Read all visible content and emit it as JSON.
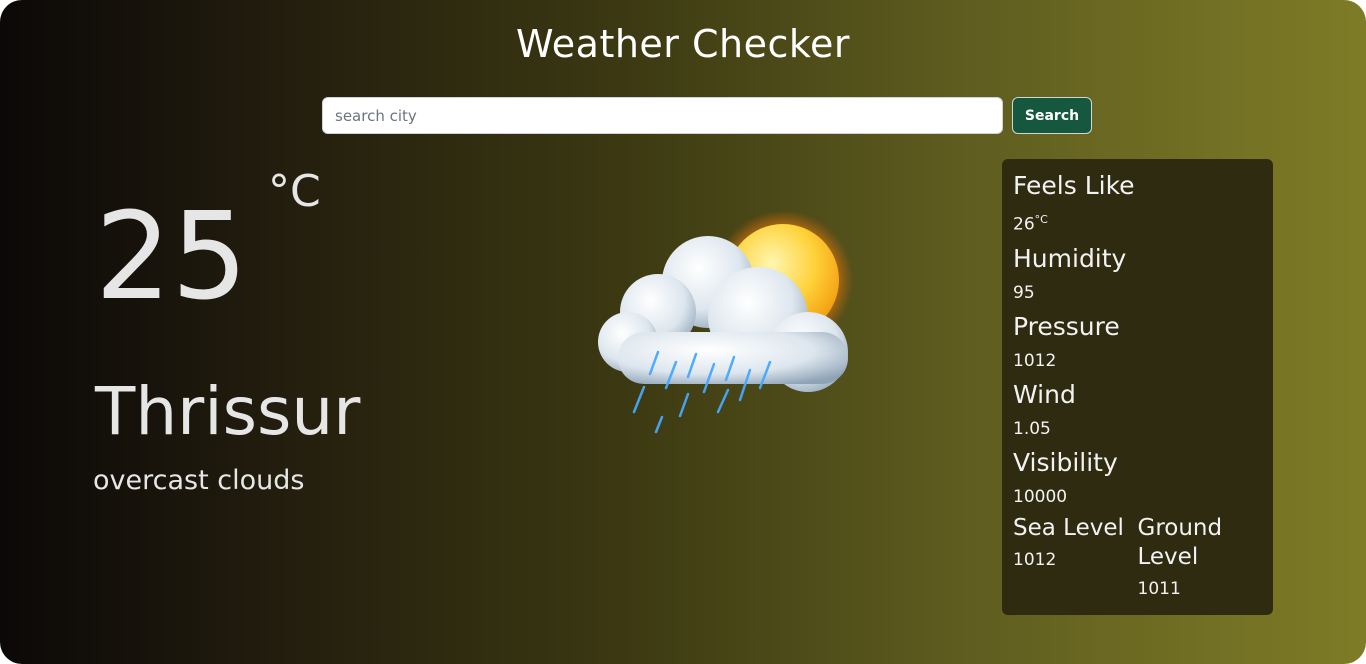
{
  "app": {
    "title": "Weather Checker"
  },
  "search": {
    "placeholder": "search city",
    "value": "",
    "button_label": "Search"
  },
  "current": {
    "temperature": "25",
    "unit": "°C",
    "city": "Thrissur",
    "description": "overcast clouds",
    "icon": "cloud-sun-rain-icon"
  },
  "details": {
    "feels_like": {
      "label": "Feels Like",
      "value": "26",
      "unit": "°C"
    },
    "humidity": {
      "label": "Humidity",
      "value": "95"
    },
    "pressure": {
      "label": "Pressure",
      "value": "1012"
    },
    "wind": {
      "label": "Wind",
      "value": "1.05"
    },
    "visibility": {
      "label": "Visibility",
      "value": "10000"
    },
    "sea_level": {
      "label": "Sea Level",
      "value": "1012"
    },
    "ground_level": {
      "label": "Ground Level",
      "value": "1011"
    }
  },
  "colors": {
    "background_start": "#0b0808",
    "background_end": "#7e7c26",
    "button": "#15573f",
    "panel": "#2e2b11"
  }
}
